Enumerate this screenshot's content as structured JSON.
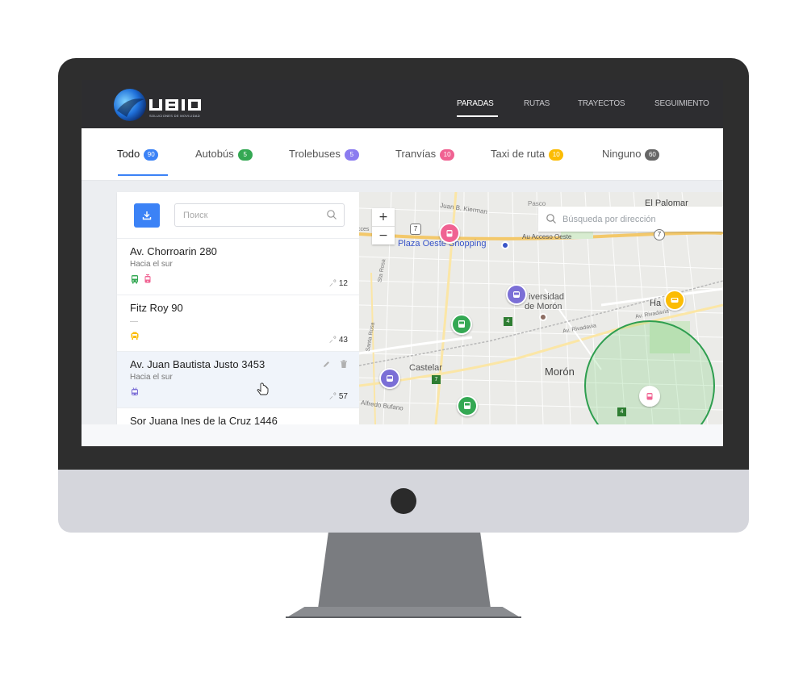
{
  "brand": {
    "logo_text": "UBIQ",
    "tagline": "SOLUCIONES DE MOVILIDAD",
    "accent": "#3b82f6"
  },
  "nav": {
    "items": [
      {
        "label": "PARADAS",
        "active": true
      },
      {
        "label": "RUTAS",
        "active": false
      },
      {
        "label": "TRAYECTOS",
        "active": false
      },
      {
        "label": "SEGUIMIENTO",
        "active": false
      }
    ]
  },
  "tabs": [
    {
      "label": "Todo",
      "count": "90",
      "color": "#3b82f6"
    },
    {
      "label": "Autobús",
      "count": "5",
      "color": "#34a853"
    },
    {
      "label": "Trolebuses",
      "count": "5",
      "color": "#8b7cf0"
    },
    {
      "label": "Tranvías",
      "count": "10",
      "color": "#f06292"
    },
    {
      "label": "Taxi de ruta",
      "count": "10",
      "color": "#fbbc04"
    },
    {
      "label": "Ninguno",
      "count": "60",
      "color": "#666666"
    }
  ],
  "list": {
    "search_placeholder": "Поиск",
    "stops": [
      {
        "name": "Av. Chorroarin 280",
        "direction": "Hacia el sur",
        "vehicles": [
          "bus-icon",
          "tram-icon"
        ],
        "count": "12"
      },
      {
        "name": "Fitz Roy 90",
        "direction": "",
        "vehicles": [
          "taxi-icon"
        ],
        "count": "43"
      },
      {
        "name": "Av. Juan Bautista Justo 3453",
        "direction": "Hacia el sur",
        "vehicles": [
          "trolley-icon"
        ],
        "count": "57",
        "selected": true
      },
      {
        "name": "Sor Juana Ines de la Cruz 1446",
        "direction": "",
        "vehicles": [],
        "count": ""
      }
    ]
  },
  "map": {
    "search_placeholder": "Búsqueda por dirección",
    "zoom_in": "+",
    "zoom_out": "−",
    "labels": {
      "el_palomar": "El Palomar",
      "plaza_oeste": "Plaza Oeste Shopping",
      "au_acceso": "Au Acceso Oeste",
      "universidad": "iversidad",
      "de_moron": "de Morón",
      "moron": "Morón",
      "castelar": "Castelar",
      "rivadavia": "Av. Rivadavia",
      "rivadavia2": "Av. Rivadavia",
      "juan_kierman": "Juan B. Kierman",
      "alfredo": "Alfredo Bufano",
      "pascua": "Pasco",
      "sta_rosa": "Sta Rosa",
      "sta_rosa2": "Santa Rosa",
      "ha": "Ha",
      "road7": "7",
      "road7b": "7",
      "road7c": "7",
      "road4": "4",
      "road4b": "4",
      "road_circle7": "7",
      "acces": "cces"
    }
  }
}
